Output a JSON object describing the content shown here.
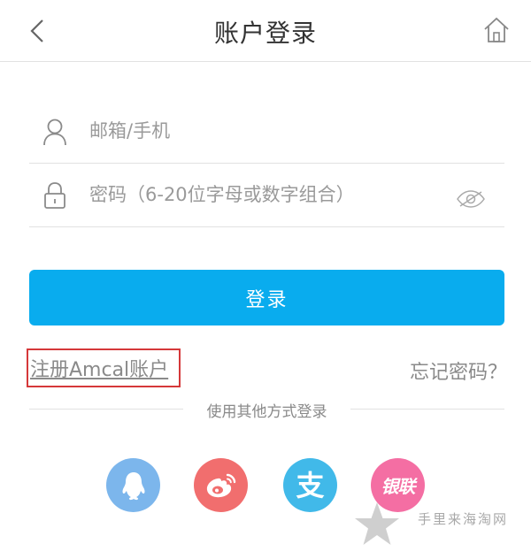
{
  "header": {
    "title": "账户登录",
    "back_icon": "chevron-left-icon",
    "home_icon": "home-icon"
  },
  "form": {
    "email": {
      "placeholder": "邮箱/手机",
      "value": "",
      "icon": "user-icon"
    },
    "password": {
      "placeholder": "密码（6-20位字母或数字组合）",
      "value": "",
      "icon": "lock-icon",
      "toggle_icon": "eye-icon"
    },
    "login_label": "登录"
  },
  "links": {
    "register": "注册Amcal账户",
    "forgot": "忘记密码？"
  },
  "other_login": {
    "label": "使用其他方式登录",
    "providers": [
      {
        "name": "qq",
        "icon": "qq-penguin-icon",
        "color": "#7cb6ec"
      },
      {
        "name": "weibo",
        "icon": "weibo-icon",
        "color": "#f16e6e"
      },
      {
        "name": "alipay",
        "icon": "alipay-icon",
        "color": "#41b9e9",
        "glyph": "支"
      },
      {
        "name": "unionpay",
        "icon": "unionpay-icon",
        "color": "#f46ea3",
        "glyph": "银联"
      }
    ]
  },
  "colors": {
    "accent": "#09acee",
    "highlight_box": "#d5383a",
    "muted_text": "#8a8a8a",
    "divider": "#e2e2e2"
  },
  "watermark": {
    "text": "手里来海淘网",
    "icon": "star-icon"
  }
}
